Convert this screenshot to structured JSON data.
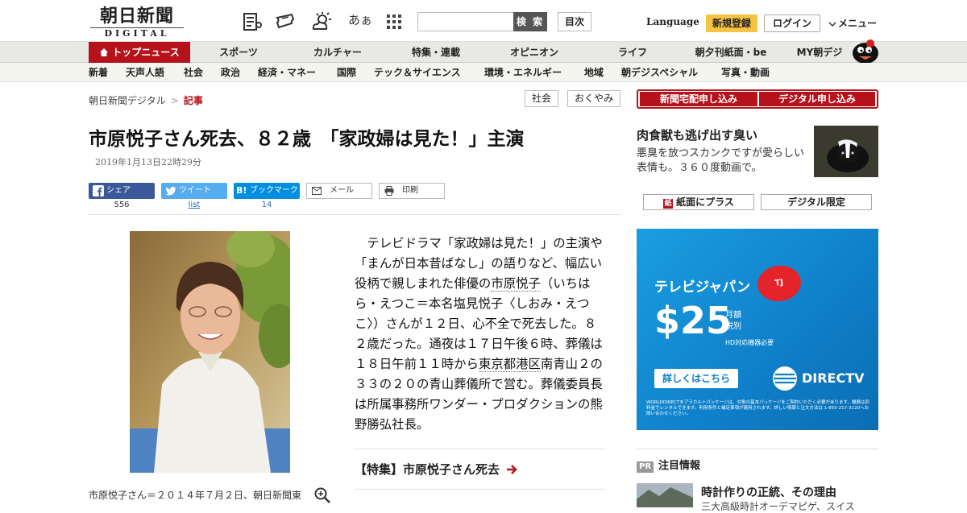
{
  "header": {
    "logo_main": "朝日新聞",
    "logo_sub": "DIGITAL",
    "icons": [
      "newspaper-icon",
      "ticket-icon",
      "weather-icon",
      "font-size-icon",
      "grid-icon"
    ],
    "font_icon_text": "あぁ",
    "search_placeholder": "",
    "search_button": "検 索",
    "index_button": "目次",
    "language": "Language",
    "signup": "新規登録",
    "login": "ログイン",
    "menu": "メニュー"
  },
  "nav_main": [
    {
      "label": "トップニュース"
    },
    {
      "label": "スポーツ"
    },
    {
      "label": "カルチャー"
    },
    {
      "label": "特集・連載"
    },
    {
      "label": "オピニオン"
    },
    {
      "label": "ライフ"
    },
    {
      "label": "朝夕刊紙面・be"
    },
    {
      "label": "MY朝デジ"
    }
  ],
  "nav_sub": [
    "新着",
    "天声人語",
    "社会",
    "政治",
    "経済・マネー",
    "国際",
    "テック＆サイエンス",
    "環境・エネルギー",
    "地域",
    "朝デジスペシャル",
    "写真・動画"
  ],
  "breadcrumb": {
    "home": "朝日新聞デジタル",
    "sep": ">",
    "current": "記事"
  },
  "tags": [
    "社会",
    "おくやみ"
  ],
  "article": {
    "title": "市原悦子さん死去、８２歳　「家政婦は見た！」主演",
    "date": "2019年1月13日22時29分",
    "share": {
      "facebook": {
        "label": "シェア",
        "count": "556"
      },
      "twitter": {
        "label": "ツイート",
        "count": "list"
      },
      "hatena": {
        "label": "ブックマーク",
        "count": "14"
      },
      "mail": "メール",
      "print": "印刷"
    },
    "body_1": "　テレビドラマ「家政婦は見た！」の主演や「まんが日本昔ばなし」の語りなど、幅広い役柄で親しまれた俳優の",
    "body_link1": "市原悦子",
    "body_2": "（いちはら・えつこ＝本名塩見悦子〈しおみ・えつこ〉）さんが１２日、心不全で死去した。８２歳だった。通夜は１７日午後６時、葬儀は１８日午前１１時から",
    "body_link2": "東京都港区",
    "body_3": "南青山２の３３の２０の青山葬儀所で営む。葬儀委員長は所属事務所ワンダー・プロダクションの熊野勝弘社長。",
    "related": "【特集】市原悦子さん死去",
    "caption": "市原悦子さん＝２０１４年７月２日、朝日新聞東"
  },
  "sidebar": {
    "btn_delivery": "新聞宅配申し込み",
    "btn_digital": "デジタル申し込み",
    "rec_title": "肉食獣も逃げ出す臭い",
    "rec_desc": "悪臭を放つスカンクですが愛らしい表情も。３６０度動画で。",
    "btn_paper_plus": "紙面にプラス",
    "btn_digital_only": "デジタル限定",
    "ad": {
      "brand": "テレビジャパン",
      "price": "$25",
      "monthly": "月額",
      "tax": "税別",
      "hd": "HD対応機器必要",
      "details": "詳しくはこちら",
      "provider": "DIRECTV",
      "fine_print": "WORLDDIRECT®アラカルトパッケージは、対象の基本パッケージをご契約いただく必要があります。機器は別料金でレンタルできます。利用条件と補足事項が適用されます。詳しい情報と注文方法は 1-855-217-3120へお問い合わせください。"
    },
    "pr_badge": "PR",
    "pr_heading": "注目情報",
    "pr_title": "時計作りの正統、その理由",
    "pr_sub": "三大高級時計オーデマピゲ、スイス"
  },
  "colors": {
    "brand_red": "#b5121b",
    "signup_yellow": "#f6c343",
    "facebook": "#3b5998",
    "twitter": "#55acee",
    "hatena": "#008fde"
  }
}
